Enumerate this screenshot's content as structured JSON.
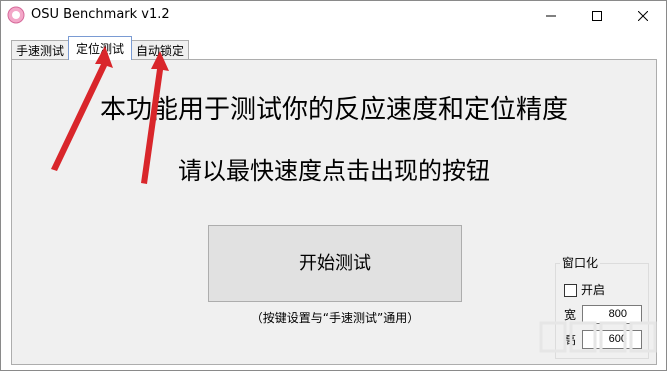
{
  "window": {
    "title": "OSU Benchmark v1.2"
  },
  "tabs": [
    {
      "label": "手速测试"
    },
    {
      "label": "定位测试",
      "active": true
    },
    {
      "label": "自动锁定"
    }
  ],
  "main": {
    "headline": "本功能用于测试你的反应速度和定位精度",
    "subline": "请以最快速度点击出现的按钮",
    "start_button": "开始测试",
    "note": "（按键设置与“手速测试”通用）"
  },
  "windowed_group": {
    "title": "窗口化",
    "enable_label": "开启",
    "enable_checked": false,
    "width_label": "宽",
    "width_value": "800",
    "height_label": "高",
    "height_value": "600"
  },
  "colors": {
    "annotation_arrow": "#d9262b",
    "panel_bg": "#f0f0f0",
    "active_tab_border": "#7a9bd3"
  },
  "icons": [
    "app-icon",
    "minimize-icon",
    "maximize-icon",
    "close-icon"
  ]
}
